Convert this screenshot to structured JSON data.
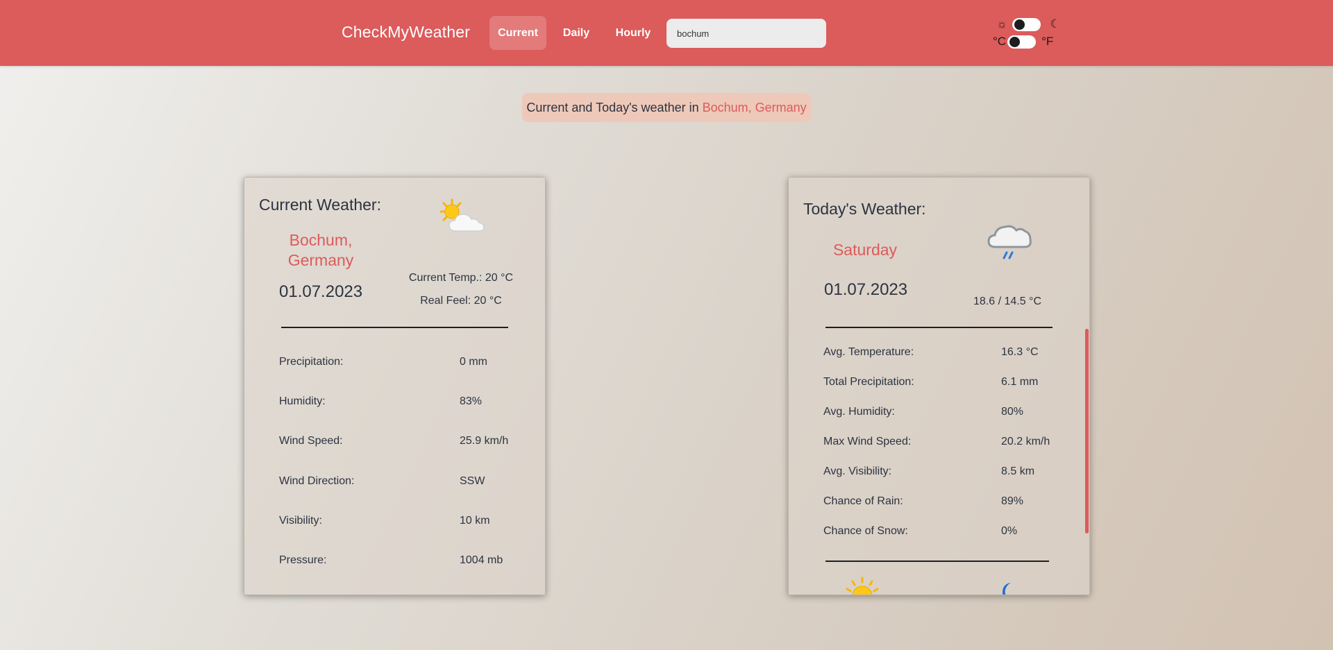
{
  "navbar": {
    "brand": "CheckMyWeather",
    "links": [
      "Current",
      "Daily",
      "Hourly"
    ],
    "active_link": "Current",
    "search_value": "bochum",
    "theme_toggle": {
      "left_icon": "sun-icon",
      "right_icon": "moon-icon",
      "left_glyph": "☼",
      "right_glyph": "☾"
    },
    "unit_toggle": {
      "left": "°C",
      "right": "°F"
    }
  },
  "heading": {
    "prefix": "Current and Today's weather in ",
    "location": "Bochum, Germany"
  },
  "current_card": {
    "title": "Current Weather:",
    "city": "Bochum,",
    "country": "Germany",
    "date": "01.07.2023",
    "current_temp": "Current Temp.: 20 °C",
    "real_feel": "Real Feel: 20 °C",
    "icon": "partly-cloudy-icon",
    "rows": [
      {
        "label": "Precipitation:",
        "value": "0 mm"
      },
      {
        "label": "Humidity:",
        "value": "83%"
      },
      {
        "label": "Wind Speed:",
        "value": "25.9 km/h"
      },
      {
        "label": "Wind Direction:",
        "value": "SSW"
      },
      {
        "label": "Visibility:",
        "value": "10 km"
      },
      {
        "label": "Pressure:",
        "value": "1004 mb"
      }
    ]
  },
  "today_card": {
    "title": "Today's Weather:",
    "day": "Saturday",
    "date": "01.07.2023",
    "temp_range": "18.6 / 14.5 °C",
    "icon": "light-rain-icon",
    "rows": [
      {
        "label": "Avg. Temperature:",
        "value": "16.3 °C"
      },
      {
        "label": "Total Precipitation:",
        "value": "6.1 mm"
      },
      {
        "label": "Avg. Humidity:",
        "value": "80%"
      },
      {
        "label": "Max Wind Speed:",
        "value": "20.2 km/h"
      },
      {
        "label": "Avg. Visibility:",
        "value": "8.5 km"
      },
      {
        "label": "Chance of Rain:",
        "value": "89%"
      },
      {
        "label": "Chance of Snow:",
        "value": "0%"
      }
    ],
    "bottom_icons": [
      "sunrise-icon",
      "moonrise-icon"
    ]
  },
  "colors": {
    "accent": "#dc5b5b",
    "text": "#2c3340",
    "pill": "#eec9b9"
  }
}
